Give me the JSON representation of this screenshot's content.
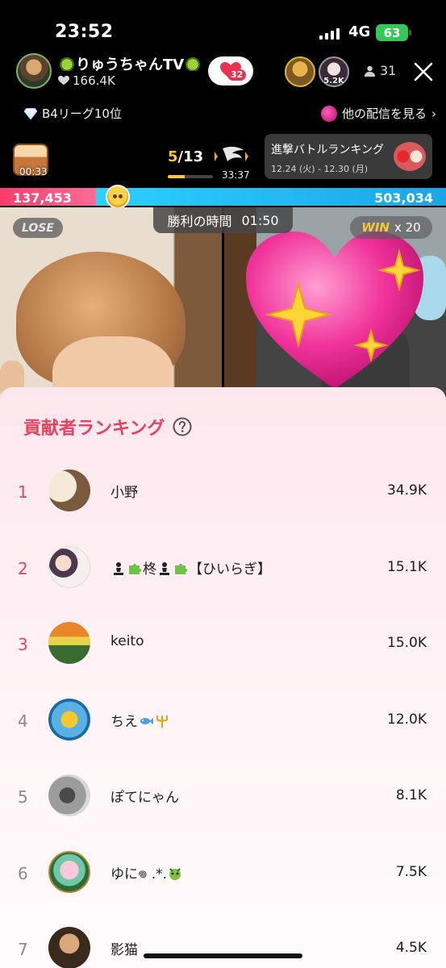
{
  "status_bar": {
    "time": "23:52",
    "network": "4G",
    "battery": "63"
  },
  "host": {
    "name": "りゅうちゃんTV",
    "likes": "166.4K",
    "gift_count": "32"
  },
  "top_viewers": [
    {
      "label": ""
    },
    {
      "label": "5.2K"
    }
  ],
  "viewer_count": "31",
  "league": {
    "label": "B4リーグ10位"
  },
  "other_live": {
    "label": "他の配信を見る"
  },
  "chest": {
    "timer": "00:33"
  },
  "battle": {
    "round_current": "5",
    "round_total": "/13",
    "round_progress": 0.38,
    "timer": "33:37",
    "victory_label": "勝利の時間",
    "victory_time": "01:50",
    "lose_label": "LOSE",
    "win_label": "WIN",
    "win_multiplier": "x 20"
  },
  "ranking_card": {
    "title": "進撃バトルランキング",
    "dates": "12.24 (火) - 12.30 (月)"
  },
  "score": {
    "left": "137,453",
    "right": "503,034",
    "left_value": 137453,
    "right_value": 503034
  },
  "contributors": {
    "title": "貢献者ランキング",
    "rows": [
      {
        "rank": "1",
        "name": "小野",
        "score": "34.9K"
      },
      {
        "rank": "2",
        "name_pre": "",
        "name": "柊",
        "name_post": "【ひいらぎ】",
        "score": "15.1K"
      },
      {
        "rank": "3",
        "name": "keito",
        "score": "15.0K"
      },
      {
        "rank": "4",
        "name": "ちえ",
        "score": "12.0K"
      },
      {
        "rank": "5",
        "name": "ぽてにゃん",
        "score": "8.1K"
      },
      {
        "rank": "6",
        "name": "ゆに𖦹 .*.",
        "score": "7.5K"
      },
      {
        "rank": "7",
        "name": "影猫",
        "score": "4.5K"
      }
    ]
  },
  "colors": {
    "accent": "#e8415f",
    "score_left": "#ff3b6d",
    "score_right": "#1aa6e6",
    "gold": "#f8c63a"
  }
}
